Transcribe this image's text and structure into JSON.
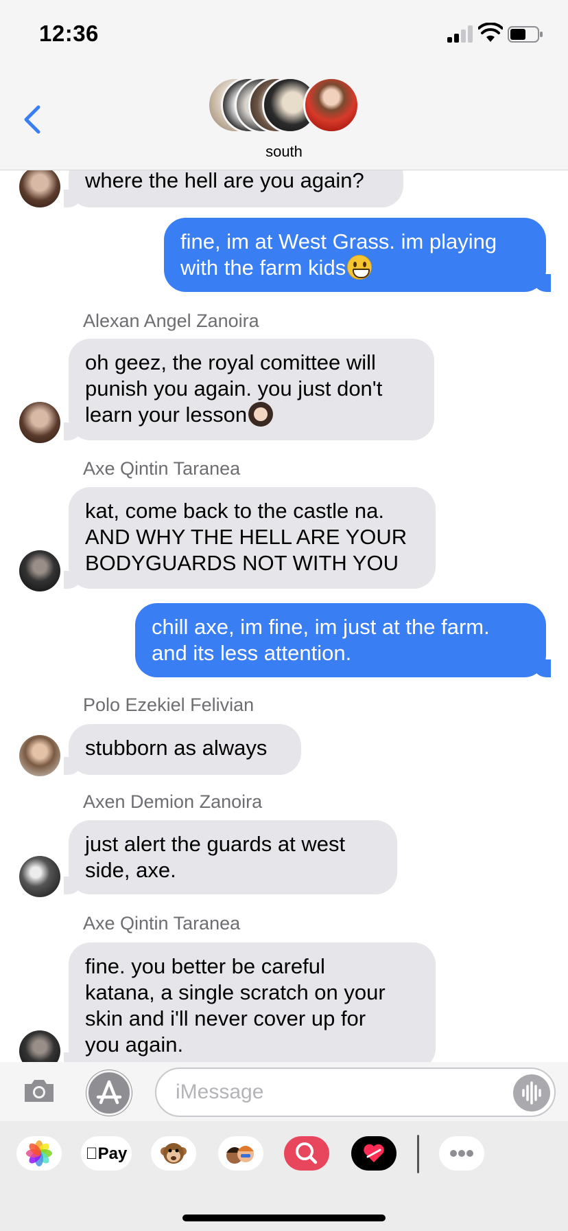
{
  "status": {
    "time": "12:36"
  },
  "conversation": {
    "name": "south"
  },
  "colors": {
    "accent": "#3a7ef4",
    "incoming_bubble": "#e5e5ea",
    "sender_name": "#6d6d72"
  },
  "messages": [
    {
      "type": "incoming",
      "sender": "",
      "text": "where the hell are you again?"
    },
    {
      "type": "outgoing",
      "line1": "fine, im at West Grass. im playing",
      "line2": "with the farm kids",
      "emoji": "grinning-face-emoji"
    },
    {
      "type": "incoming",
      "sender": "Alexan Angel Zanoira",
      "line1": "oh geez, the royal comittee will",
      "line2": "punish you again. you just don't",
      "line3": "learn your lesson",
      "emoji": "woman-facepalming-emoji"
    },
    {
      "type": "incoming",
      "sender": "Axe Qintin Taranea",
      "line1": "kat, come back to the castle na.",
      "line2": "AND WHY THE HELL ARE YOUR",
      "line3": "BODYGUARDS NOT WITH YOU"
    },
    {
      "type": "outgoing",
      "line1": "chill axe, im fine, im just at the farm.",
      "line2": "and its less attention."
    },
    {
      "type": "incoming",
      "sender": "Polo Ezekiel Felivian",
      "text": "stubborn as always"
    },
    {
      "type": "incoming",
      "sender": "Axen Demion Zanoira",
      "line1": "just alert the guards at west",
      "line2": "side, axe."
    },
    {
      "type": "incoming",
      "sender": "Axe Qintin Taranea",
      "line1": "fine. you better be careful",
      "line2": "katana, a single scratch on your",
      "line3": "skin and i'll never cover up for",
      "line4": "you again."
    }
  ],
  "input": {
    "placeholder": "iMessage"
  },
  "apps": [
    {
      "icon": "photos-icon"
    },
    {
      "label": "Pay",
      "icon": "apple-pay-icon"
    },
    {
      "icon": "animoji-icon"
    },
    {
      "icon": "memoji-icon"
    },
    {
      "icon": "images-search-icon"
    },
    {
      "icon": "digital-touch-icon"
    },
    {
      "icon": "more-apps-icon"
    }
  ]
}
